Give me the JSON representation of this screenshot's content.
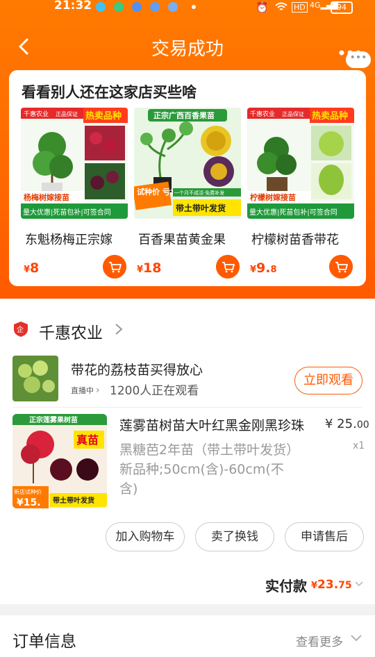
{
  "status": {
    "time": "21:32",
    "battery": "94"
  },
  "nav": {
    "title": "交易成功",
    "more_badge": "•••"
  },
  "reco": {
    "title": "看看别人还在这家店买些啥",
    "products": [
      {
        "name": "东魁杨梅正宗嫁",
        "currency": "¥",
        "price": "8",
        "decimal": "",
        "banner_a": "千惠农业",
        "banner_b": "正品保证",
        "hot": "热卖品种",
        "label": "杨梅树嫁接苗",
        "foot": "量大优惠|死苗包补|可签合同"
      },
      {
        "name": "百香果苗黄金果",
        "currency": "¥",
        "price": "18",
        "decimal": "",
        "banner_a": "正宗广西百香果苗",
        "hot": "试种价 亏本送",
        "foot": "带土带叶发货",
        "sub": "一个月不成活·免费补发"
      },
      {
        "name": "柠檬树苗香带花",
        "currency": "¥",
        "price": "9.",
        "decimal": "8",
        "banner_a": "千惠农业",
        "banner_b": "正品保证",
        "hot": "热卖品种",
        "label": "柠檬树嫁接苗",
        "foot": "量大优惠|死苗包补|可签合同"
      }
    ]
  },
  "shop": {
    "name": "千惠农业",
    "live": {
      "text": "带花的荔枝苗买得放心",
      "tag": "直播中",
      "watching": "1200人正在观看",
      "button": "立即观看"
    },
    "order": {
      "title": "莲雾苗树苗大叶红黑金刚黑珍珠",
      "price_int": "¥ 25.",
      "price_dec": "00",
      "qty": "x1",
      "spec": "黑糖芭2年苗（带土带叶发货）新品种;50cm(含)-60cm(不含)",
      "thumb_banner": "正宗莲雾果树苗",
      "thumb_tag": "真苗",
      "thumb_price_label": "新店试种价",
      "thumb_price": "¥15.",
      "thumb_foot": "带土带叶发货"
    },
    "buttons": [
      "加入购物车",
      "卖了换钱",
      "申请售后"
    ],
    "total_label": "实付款",
    "total_currency": "¥",
    "total_int": "23.",
    "total_dec": "75"
  },
  "order_info": {
    "title": "订单信息",
    "more": "查看更多"
  },
  "colors": {
    "accent": "#ff5a00",
    "hero": "#ff7a00",
    "price": "#ff4400"
  }
}
